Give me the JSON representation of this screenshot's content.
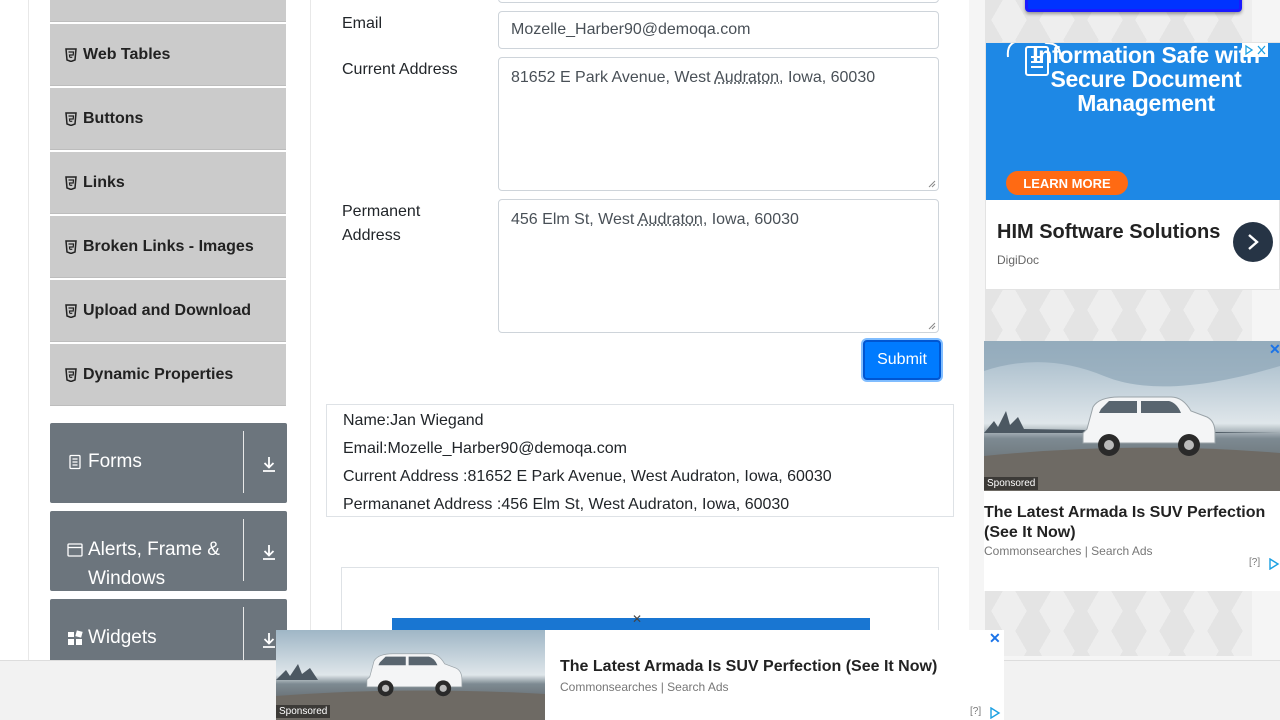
{
  "sidebar": {
    "items": [
      {
        "label": "Web Tables"
      },
      {
        "label": "Buttons"
      },
      {
        "label": "Links"
      },
      {
        "label": "Broken Links - Images"
      },
      {
        "label": "Upload and Download"
      },
      {
        "label": "Dynamic Properties"
      }
    ],
    "groups": [
      {
        "label": "Forms"
      },
      {
        "label_line1": "Alerts, Frame &",
        "label_line2": "Windows"
      },
      {
        "label": "Widgets"
      }
    ]
  },
  "form": {
    "email_label": "Email",
    "email_value": "Mozelle_Harber90@demoqa.com",
    "current_address_label": "Current Address",
    "current_address": {
      "before": "81652 E Park Avenue, West ",
      "underlined": "Audraton",
      "after": ", Iowa, 60030"
    },
    "permanent_address_label_line1": "Permanent",
    "permanent_address_label_line2": "Address",
    "permanent_address": {
      "before": "456 Elm St, West ",
      "underlined": "Audraton",
      "after": ", Iowa, 60030"
    },
    "submit_label": "Submit"
  },
  "output": {
    "name": "Name:Jan Wiegand",
    "email": "Email:Mozelle_Harber90@demoqa.com",
    "current_address": "Current Address :81652 E Park Avenue, West Audraton, Iowa, 60030",
    "permanent_address": "Permananet Address :456 Elm St, West Audraton, Iowa, 60030"
  },
  "ads": {
    "ad1": {
      "banner_text": "Information Safe with Secure Document Management",
      "cta": "LEARN MORE",
      "title": "HIM Software Solutions",
      "advertiser": "DigiDoc"
    },
    "ad2": {
      "sponsored": "Sponsored",
      "title": "The Latest Armada Is SUV Perfection (See It Now)",
      "source": "Commonsearches | Search Ads",
      "help": "[?]"
    },
    "sticky": {
      "sponsored": "Sponsored",
      "title": "The Latest Armada Is SUV Perfection (See It Now)",
      "source": "Commonsearches | Search Ads",
      "help": "[?]",
      "close": "✕"
    }
  },
  "colors": {
    "primary": "#007bff",
    "sidebar_item_bg": "#cbcbcb",
    "group_bg": "#6c757d",
    "ad_blue": "#1e88e5",
    "ad_orange": "#ff6a13"
  }
}
